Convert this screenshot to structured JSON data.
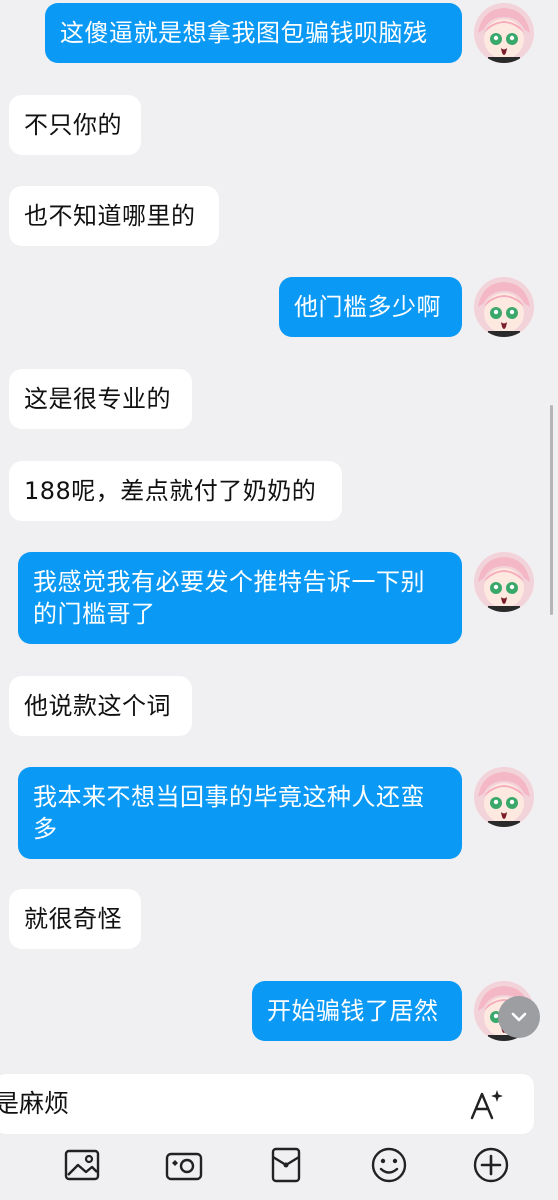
{
  "messages": [
    {
      "side": "right",
      "text": "这傻逼就是想拿我图包骗钱呗脑残"
    },
    {
      "side": "left",
      "text": "不只你的"
    },
    {
      "side": "left",
      "text": "也不知道哪里的"
    },
    {
      "side": "right",
      "text": "他门槛多少啊"
    },
    {
      "side": "left",
      "text": "这是很专业的"
    },
    {
      "side": "left",
      "text": "188呢，差点就付了奶奶的"
    },
    {
      "side": "right",
      "text": "我感觉我有必要发个推特告诉一下别的门槛哥了"
    },
    {
      "side": "left",
      "text": "他说款这个词"
    },
    {
      "side": "right",
      "text": "我本来不想当回事的毕竟这种人还蛮多"
    },
    {
      "side": "left",
      "text": "就很奇怪"
    },
    {
      "side": "right",
      "text": "开始骗钱了居然"
    }
  ],
  "input": {
    "value": "是麻烦"
  },
  "icons": {
    "font_style": "font-size-icon",
    "scroll_down": "chevron-down-icon",
    "toolbar": [
      "image-icon",
      "camera-icon",
      "red-packet-icon",
      "emoji-icon",
      "plus-icon"
    ]
  },
  "colors": {
    "accent": "#0a99f5",
    "background": "#f0f0f2",
    "bubble_left": "#ffffff"
  }
}
